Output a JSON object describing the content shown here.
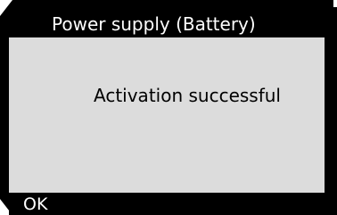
{
  "header": {
    "title": "Power supply (Battery)"
  },
  "content": {
    "message": "Activation successful"
  },
  "softkeys": {
    "ok_label": "OK"
  },
  "colors": {
    "background": "#000000",
    "panel": "#dcdcdc",
    "title_text": "#ffffff",
    "message_text": "#000000"
  }
}
